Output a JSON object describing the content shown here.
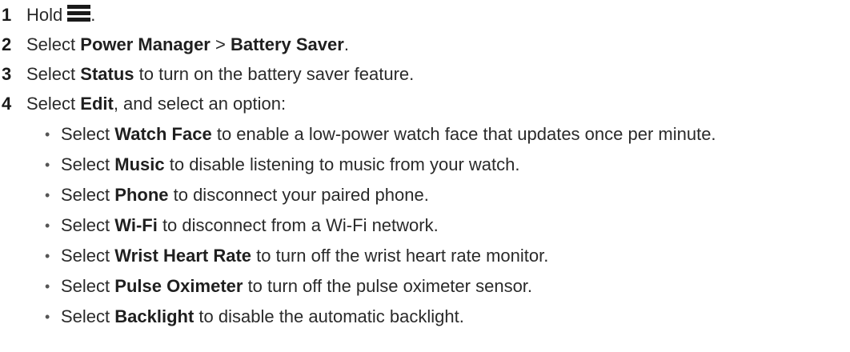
{
  "steps": [
    {
      "num": "1",
      "pre": "Hold",
      "post": "."
    },
    {
      "num": "2",
      "pre": "Select ",
      "b1": "Power Manager",
      "mid": " > ",
      "b2": "Battery Saver",
      "post": "."
    },
    {
      "num": "3",
      "pre": "Select ",
      "b1": "Status",
      "post": " to turn on the battery saver feature."
    },
    {
      "num": "4",
      "pre": "Select ",
      "b1": "Edit",
      "post": ", and select an option:"
    }
  ],
  "bullet_char": "•",
  "bullets": [
    {
      "pre": "Select ",
      "bold": "Watch Face",
      "post": " to enable a low-power watch face that updates once per minute."
    },
    {
      "pre": "Select ",
      "bold": "Music",
      "post": " to disable listening to music from your watch."
    },
    {
      "pre": "Select ",
      "bold": "Phone",
      "post": " to disconnect your paired phone."
    },
    {
      "pre": "Select ",
      "bold": "Wi-Fi",
      "post": " to disconnect from a Wi-Fi network."
    },
    {
      "pre": "Select ",
      "bold": "Wrist Heart Rate",
      "post": " to turn off the wrist heart rate monitor."
    },
    {
      "pre": "Select ",
      "bold": "Pulse Oximeter",
      "post": " to turn off the pulse oximeter sensor."
    },
    {
      "pre": "Select ",
      "bold": "Backlight",
      "post": " to disable the automatic backlight."
    }
  ],
  "icons": {
    "menu": "menu-icon"
  }
}
